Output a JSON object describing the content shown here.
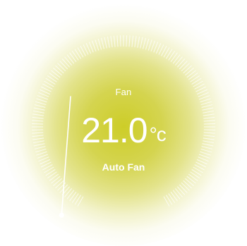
{
  "thermostat": {
    "mode_label": "Fan",
    "temperature": "21.0",
    "unit": "°c",
    "fan_mode": "Auto Fan",
    "setpoint_fraction": 0.0,
    "colors": {
      "glow": "#cdcd28",
      "text": "#ffffff",
      "ticks": "#ffffff",
      "knob": "#ffffff"
    }
  }
}
